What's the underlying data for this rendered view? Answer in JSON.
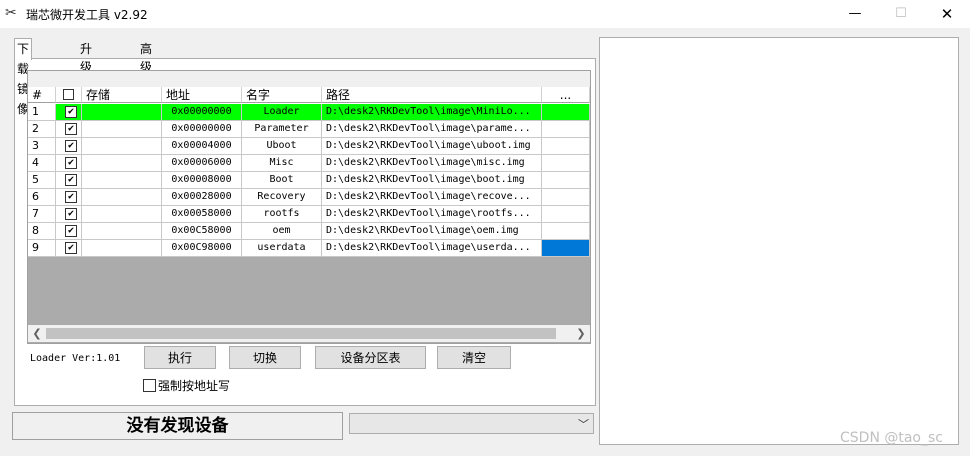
{
  "window": {
    "title": "瑞芯微开发工具 v2.92",
    "controls": {
      "minimize": "—",
      "maximize": "☐",
      "close": "✕"
    }
  },
  "tabs": [
    {
      "label": "下载镜像",
      "active": true
    },
    {
      "label": "升级固件",
      "active": false
    },
    {
      "label": "高级功能",
      "active": false
    }
  ],
  "table": {
    "headers": {
      "num": "#",
      "storage": "存储",
      "address": "地址",
      "name": "名字",
      "path": "路径",
      "more": "..."
    },
    "rows": [
      {
        "num": "1",
        "checked": true,
        "storage": "",
        "address": "0x00000000",
        "name": "Loader",
        "path": "D:\\desk2\\RKDevTool\\image\\MiniLo...",
        "highlight": true
      },
      {
        "num": "2",
        "checked": true,
        "storage": "",
        "address": "0x00000000",
        "name": "Parameter",
        "path": "D:\\desk2\\RKDevTool\\image\\parame..."
      },
      {
        "num": "3",
        "checked": true,
        "storage": "",
        "address": "0x00004000",
        "name": "Uboot",
        "path": "D:\\desk2\\RKDevTool\\image\\uboot.img"
      },
      {
        "num": "4",
        "checked": true,
        "storage": "",
        "address": "0x00006000",
        "name": "Misc",
        "path": "D:\\desk2\\RKDevTool\\image\\misc.img"
      },
      {
        "num": "5",
        "checked": true,
        "storage": "",
        "address": "0x00008000",
        "name": "Boot",
        "path": "D:\\desk2\\RKDevTool\\image\\boot.img"
      },
      {
        "num": "6",
        "checked": true,
        "storage": "",
        "address": "0x00028000",
        "name": "Recovery",
        "path": "D:\\desk2\\RKDevTool\\image\\recove..."
      },
      {
        "num": "7",
        "checked": true,
        "storage": "",
        "address": "0x00058000",
        "name": "rootfs",
        "path": "D:\\desk2\\RKDevTool\\image\\rootfs..."
      },
      {
        "num": "8",
        "checked": true,
        "storage": "",
        "address": "0x00C58000",
        "name": "oem",
        "path": "D:\\desk2\\RKDevTool\\image\\oem.img"
      },
      {
        "num": "9",
        "checked": true,
        "storage": "",
        "address": "0x00C98000",
        "name": "userdata",
        "path": "D:\\desk2\\RKDevTool\\image\\userda...",
        "selected_last": true
      }
    ]
  },
  "loader_version": "Loader Ver:1.01",
  "buttons": {
    "run": "执行",
    "switch": "切换",
    "partition_table": "设备分区表",
    "clear": "清空"
  },
  "force_address_write": {
    "label": "强制按地址写",
    "checked": false
  },
  "status_text": "没有发现设备",
  "combo": {
    "value": ""
  },
  "watermark": "CSDN @tao_sc",
  "colors": {
    "highlight_row": "#00ff00",
    "selected_cell": "#0078d7"
  }
}
